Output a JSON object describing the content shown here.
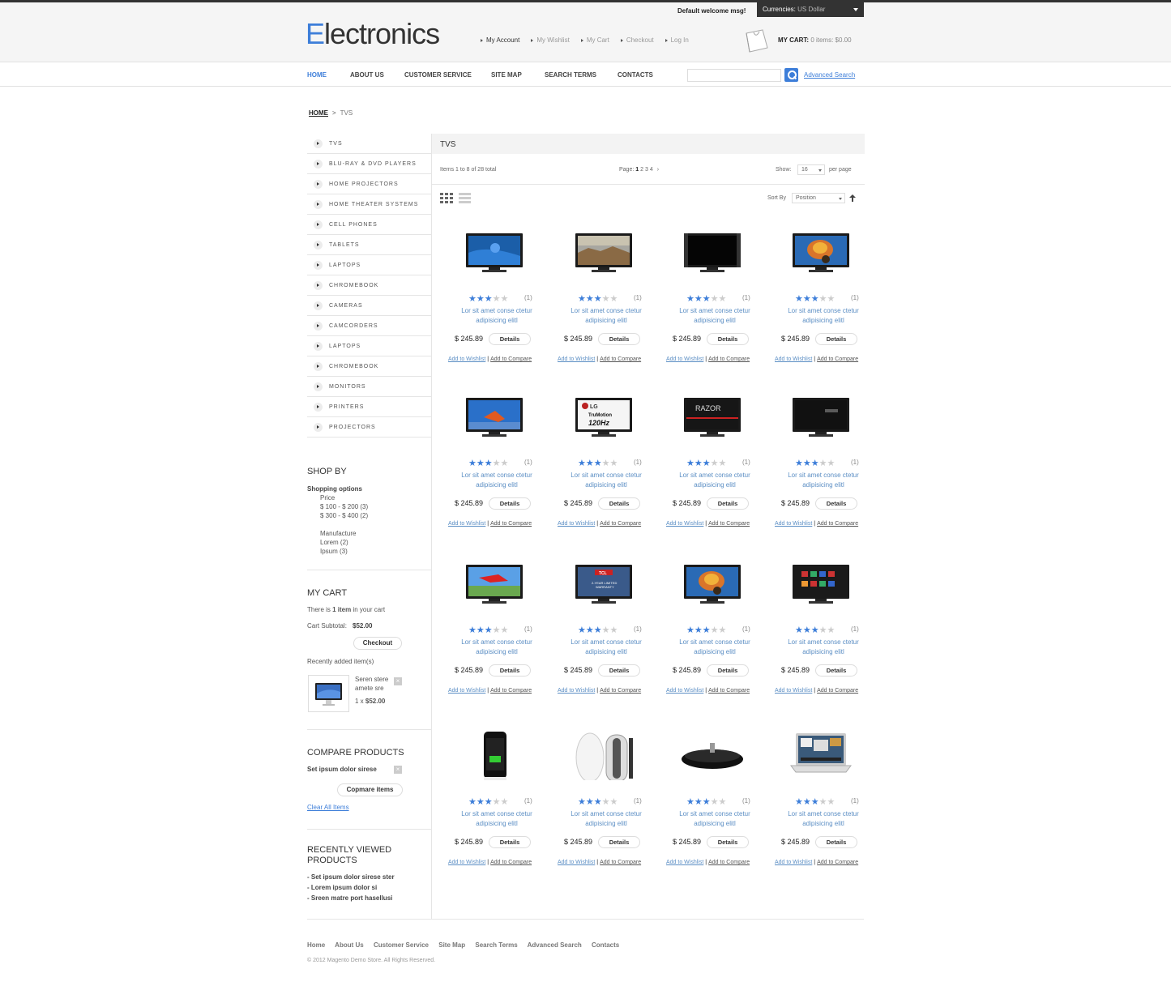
{
  "header": {
    "logo_first": "E",
    "logo_rest": "lectronics",
    "welcome": "Default welcome msg!",
    "currency_label": "Currencies:",
    "currency_value": "US Dollar",
    "links": [
      "My Account",
      "My Wishlist",
      "My Cart",
      "Checkout",
      "Log In"
    ],
    "cart_label": "MY CART:",
    "cart_value": "0 items: $0.00"
  },
  "nav": {
    "items": [
      "HOME",
      "ABOUT US",
      "CUSTOMER SERVICE",
      "SITE MAP",
      "SEARCH TERMS",
      "CONTACTS"
    ],
    "search_value": "",
    "advanced_search": "Advanced Search"
  },
  "breadcrumb": {
    "home": "HOME",
    "sep": ">",
    "current": "TVS"
  },
  "sidebar": {
    "categories": [
      "TVS",
      "BLU-RAY & DVD PLAYERS",
      "HOME PROJECTORS",
      "HOME THEATER SYSTEMS",
      "CELL PHONES",
      "TABLETS",
      "LAPTOPS",
      "CHROMEBOOK",
      "CAMERAS",
      "CAMCORDERS",
      "LAPTOPS",
      "CHROMEBOOK",
      "MONITORS",
      "PRINTERS",
      "PROJECTORS"
    ],
    "shop_by": {
      "title": "SHOP BY",
      "subtitle": "Shopping options",
      "price_label": "Price",
      "price_options": [
        "$ 100 - $ 200 (3)",
        "$ 300 - $ 400 (2)"
      ],
      "manufacture_label": "Manufacture",
      "manufacture_options": [
        "Lorem (2)",
        "Ipsum (3)"
      ]
    },
    "my_cart": {
      "title": "MY CART",
      "text_before": "There is ",
      "text_bold": "1 item",
      "text_after": " in your cart",
      "subtotal_label": "Cart Subtotal:",
      "subtotal_value": "$52.00",
      "checkout": "Checkout",
      "recent_label": "Recently added item(s)",
      "item_name_1": "Seren stere",
      "item_name_2": "amete sre",
      "item_qty": "1 x",
      "item_price": "$52.00",
      "remove": "×"
    },
    "compare": {
      "title": "COMPARE PRODUCTS",
      "item": "Set ipsum dolor sirese",
      "remove": "×",
      "button": "Copmare items",
      "clear": "Clear All Items"
    },
    "recent": {
      "title_1": "RECENTLY VIEWED",
      "title_2": "PRODUCTS",
      "items": [
        "- Set ipsum dolor sirese ster",
        "- Lorem ipsum dolor si",
        "- Sreen matre port hasellusi"
      ]
    }
  },
  "main": {
    "title": "TVS",
    "items_text": "Items 1 to 8 of 28 total",
    "page_label": "Page:",
    "pages": [
      "1",
      "2",
      "3",
      "4"
    ],
    "page_next": "›",
    "show_label": "Show:",
    "show_value": "16",
    "per_page": "per page",
    "sort_label": "Sort By",
    "sort_value": "Position",
    "sort_dir_icon": "up-arrow-icon"
  },
  "products": [
    {
      "image": "tv-blue",
      "rating": 3,
      "count": "(1)",
      "name_1": "Lor sit amet conse ctetur",
      "name_2": "adipisicing elitl",
      "price": "$ 245.89"
    },
    {
      "image": "tv-landscape",
      "rating": 3,
      "count": "(1)",
      "name_1": "Lor sit amet conse ctetur",
      "name_2": "adipisicing elitl",
      "price": "$ 245.89"
    },
    {
      "image": "tv-black",
      "rating": 3,
      "count": "(1)",
      "name_1": "Lor sit amet conse ctetur",
      "name_2": "adipisicing elitl",
      "price": "$ 245.89"
    },
    {
      "image": "tv-balloon",
      "rating": 3,
      "count": "(1)",
      "name_1": "Lor sit amet conse ctetur",
      "name_2": "adipisicing elitl",
      "price": "$ 245.89"
    },
    {
      "image": "tv-jumper",
      "rating": 3,
      "count": "(1)",
      "name_1": "Lor sit amet conse ctetur",
      "name_2": "adipisicing elitl",
      "price": "$ 245.89"
    },
    {
      "image": "tv-lg",
      "rating": 3,
      "count": "(1)",
      "name_1": "Lor sit amet conse ctetur",
      "name_2": "adipisicing elitl",
      "price": "$ 245.89",
      "screen_text_1": "LG",
      "screen_text_2": "TruMotion",
      "screen_text_3": "120Hz"
    },
    {
      "image": "tv-razor",
      "rating": 3,
      "count": "(1)",
      "name_1": "Lor sit amet conse ctetur",
      "name_2": "adipisicing elitl",
      "price": "$ 245.89",
      "screen_text_1": "RAZOR"
    },
    {
      "image": "tv-slim",
      "rating": 3,
      "count": "(1)",
      "name_1": "Lor sit amet conse ctetur",
      "name_2": "adipisicing elitl",
      "price": "$ 245.89"
    },
    {
      "image": "tv-cape",
      "rating": 3,
      "count": "(1)",
      "name_1": "Lor sit amet conse ctetur",
      "name_2": "adipisicing elitl",
      "price": "$ 245.89"
    },
    {
      "image": "tv-tcl",
      "rating": 3,
      "count": "(1)",
      "name_1": "Lor sit amet conse ctetur",
      "name_2": "adipisicing elitl",
      "price": "$ 245.89",
      "screen_text_1": "TCL",
      "screen_text_2": "2-YEAR LIMITED",
      "screen_text_3": "WARRANTY"
    },
    {
      "image": "tv-balloon2",
      "rating": 3,
      "count": "(1)",
      "name_1": "Lor sit amet conse ctetur",
      "name_2": "adipisicing elitl",
      "price": "$ 245.89"
    },
    {
      "image": "tv-apps",
      "rating": 3,
      "count": "(1)",
      "name_1": "Lor sit amet conse ctetur",
      "name_2": "adipisicing elitl",
      "price": "$ 245.89"
    },
    {
      "image": "phone",
      "rating": 3,
      "count": "(1)",
      "name_1": "Lor sit amet conse ctetur",
      "name_2": "adipisicing elitl",
      "price": "$ 245.89"
    },
    {
      "image": "mouse",
      "rating": 3,
      "count": "(1)",
      "name_1": "Lor sit amet conse ctetur",
      "name_2": "adipisicing elitl",
      "price": "$ 245.89"
    },
    {
      "image": "speaker",
      "rating": 3,
      "count": "(1)",
      "name_1": "Lor sit amet conse ctetur",
      "name_2": "adipisicing elitl",
      "price": "$ 245.89"
    },
    {
      "image": "laptop",
      "rating": 3,
      "count": "(1)",
      "name_1": "Lor sit amet conse ctetur",
      "name_2": "adipisicing elitl",
      "price": "$ 245.89"
    }
  ],
  "product_labels": {
    "details": "Details",
    "wishlist": "Add to Wishlist",
    "sep": "|",
    "compare": "Add to Compare"
  },
  "footer": {
    "links": [
      "Home",
      "About Us",
      "Customer Service",
      "Site Map",
      "Search Terms",
      "Advanced Search",
      "Contacts"
    ],
    "copyright": "© 2012 Magento Demo Store. All Rights Reserved."
  },
  "colors": {
    "accent": "#3d7ed9",
    "link": "#5b8ec4",
    "dark": "#333333"
  }
}
